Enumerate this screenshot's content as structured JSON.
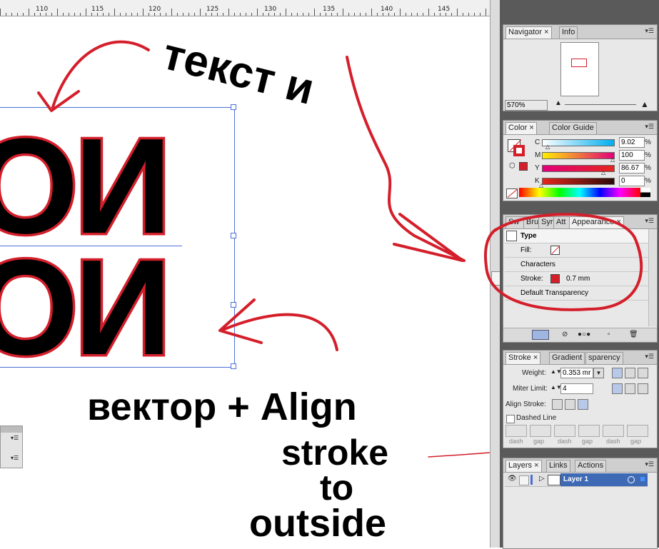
{
  "ruler": {
    "labels": [
      "110",
      "115",
      "120",
      "125",
      "130",
      "135",
      "140",
      "145"
    ]
  },
  "canvas": {
    "handwritten_top": "текст и",
    "big_text_line1": "ОИ",
    "big_text_line2": "ОИ",
    "caption_line1": "вектор + Align",
    "caption_line2": "stroke",
    "caption_line3": "to",
    "caption_line4": "outside",
    "annotation_color": "#d41f2b"
  },
  "navigator": {
    "tabs": [
      "Navigator",
      "Info"
    ],
    "zoom": "570%"
  },
  "color": {
    "tabs": [
      "Color",
      "Color Guide"
    ],
    "channels": [
      {
        "label": "C",
        "value": "9.02",
        "unit": "%",
        "level": 0.09
      },
      {
        "label": "M",
        "value": "100",
        "unit": "%",
        "level": 1.0
      },
      {
        "label": "Y",
        "value": "86.67",
        "unit": "%",
        "level": 0.87
      },
      {
        "label": "K",
        "value": "0",
        "unit": "%",
        "level": 0.0
      }
    ],
    "stroke_color": "#d41f2b"
  },
  "appearance": {
    "tabs": [
      "Sw",
      "Bru",
      "Syr",
      "Att",
      "Appearance"
    ],
    "type_label": "Type",
    "fill_label": "Fill:",
    "characters_label": "Characters",
    "stroke_label": "Stroke:",
    "stroke_value": "0.7 mm",
    "transparency_label": "Default Transparency"
  },
  "stroke": {
    "tabs": [
      "Stroke",
      "Gradient",
      "sparency"
    ],
    "weight_label": "Weight:",
    "weight_value": "0.353 mr",
    "miter_label": "Miter Limit:",
    "miter_value": "4",
    "align_label": "Align Stroke:",
    "dashed_label": "Dashed Line",
    "dash_labels": [
      "dash",
      "gap",
      "dash",
      "gap",
      "dash",
      "gap"
    ]
  },
  "layers": {
    "tabs": [
      "Layers",
      "Links",
      "Actions"
    ],
    "layer_name": "Layer 1"
  }
}
